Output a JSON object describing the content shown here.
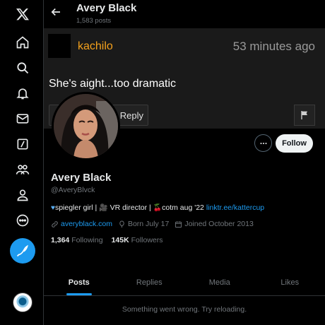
{
  "colors": {
    "accent": "#1d9bf0",
    "background": "#000000",
    "muted": "#71767b",
    "text": "#e7e9ea"
  },
  "nav": {
    "icons": [
      "x-logo-icon",
      "home-icon",
      "explore-icon",
      "notifications-icon",
      "messages-icon",
      "grok-icon",
      "communities-icon",
      "profile-icon",
      "more-icon",
      "post-icon"
    ]
  },
  "header": {
    "title": "Avery Black",
    "post_count": "1,583 posts"
  },
  "banner": {
    "username": "kachilo",
    "time": "53 minutes ago",
    "text": "She's aight...too dramatic",
    "reply_label": "Reply"
  },
  "profile": {
    "name": "Avery Black",
    "handle": "@AveryBlvck",
    "follow_label": "Follow",
    "bio": {
      "part1": "spiegler girl | ",
      "part2": " VR director | ",
      "part3": "cotm aug '22 ",
      "link": "linktr.ee/kattercup"
    },
    "website": "averyblack.com",
    "born": "Born July 17",
    "joined": "Joined October 2013",
    "following_count": "1,364",
    "following_label": "Following",
    "followers_count": "145K",
    "followers_label": "Followers"
  },
  "tabs": [
    {
      "label": "Posts",
      "active": true
    },
    {
      "label": "Replies",
      "active": false
    },
    {
      "label": "Media",
      "active": false
    },
    {
      "label": "Likes",
      "active": false
    }
  ],
  "timeline": {
    "error": "Something went wrong. Try reloading."
  }
}
